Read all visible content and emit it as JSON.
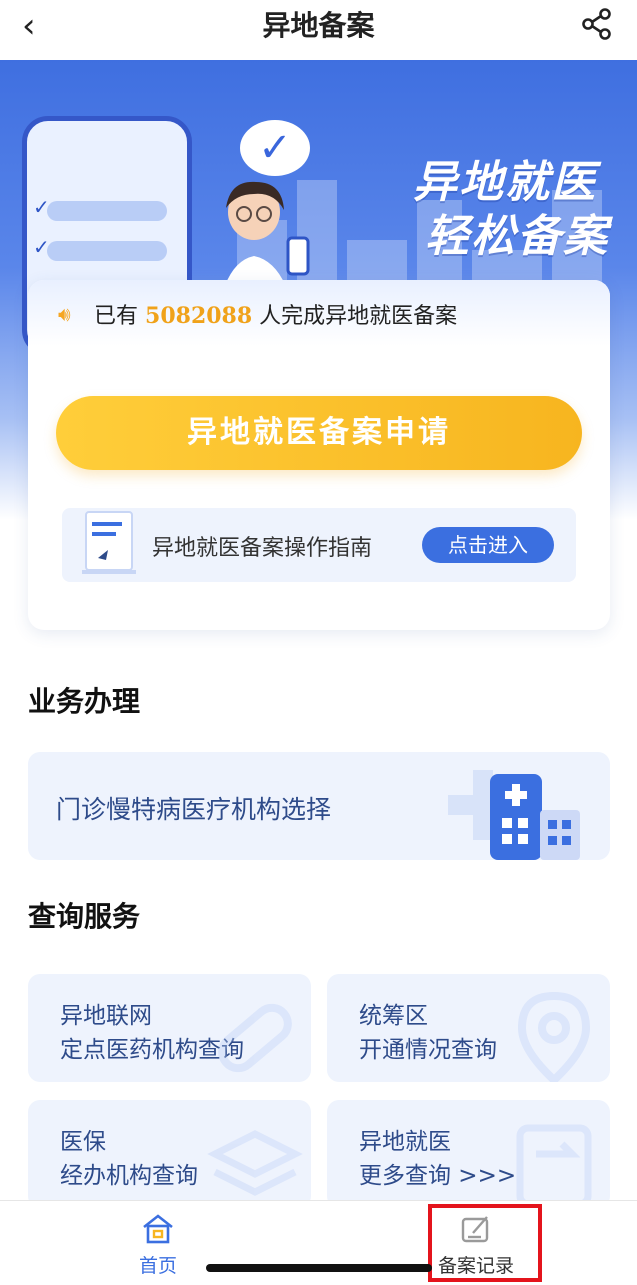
{
  "nav": {
    "title": "异地备案"
  },
  "hero": {
    "line1": "异地就医",
    "line2": "轻松备案"
  },
  "notice": {
    "prefix": "已有",
    "count": "5082088",
    "suffix": "人完成异地就医备案"
  },
  "apply": {
    "label": "异地就医备案申请"
  },
  "guide": {
    "text": "异地就医备案操作指南",
    "enter_label": "点击进入"
  },
  "business": {
    "title": "业务办理",
    "item": "门诊慢特病医疗机构选择"
  },
  "query": {
    "title": "查询服务",
    "items": [
      {
        "line1": "异地联网",
        "line2": "定点医药机构查询"
      },
      {
        "line1": "统筹区",
        "line2": "开通情况查询"
      },
      {
        "line1": "医保",
        "line2": "经办机构查询"
      },
      {
        "line1": "异地就医",
        "line2": "更多查询 >>>"
      }
    ]
  },
  "tabbar": {
    "home": "首页",
    "records": "备案记录"
  },
  "colors": {
    "primary": "#3b6fe0",
    "accent": "#f7b51f",
    "highlight": "#e4141c"
  }
}
